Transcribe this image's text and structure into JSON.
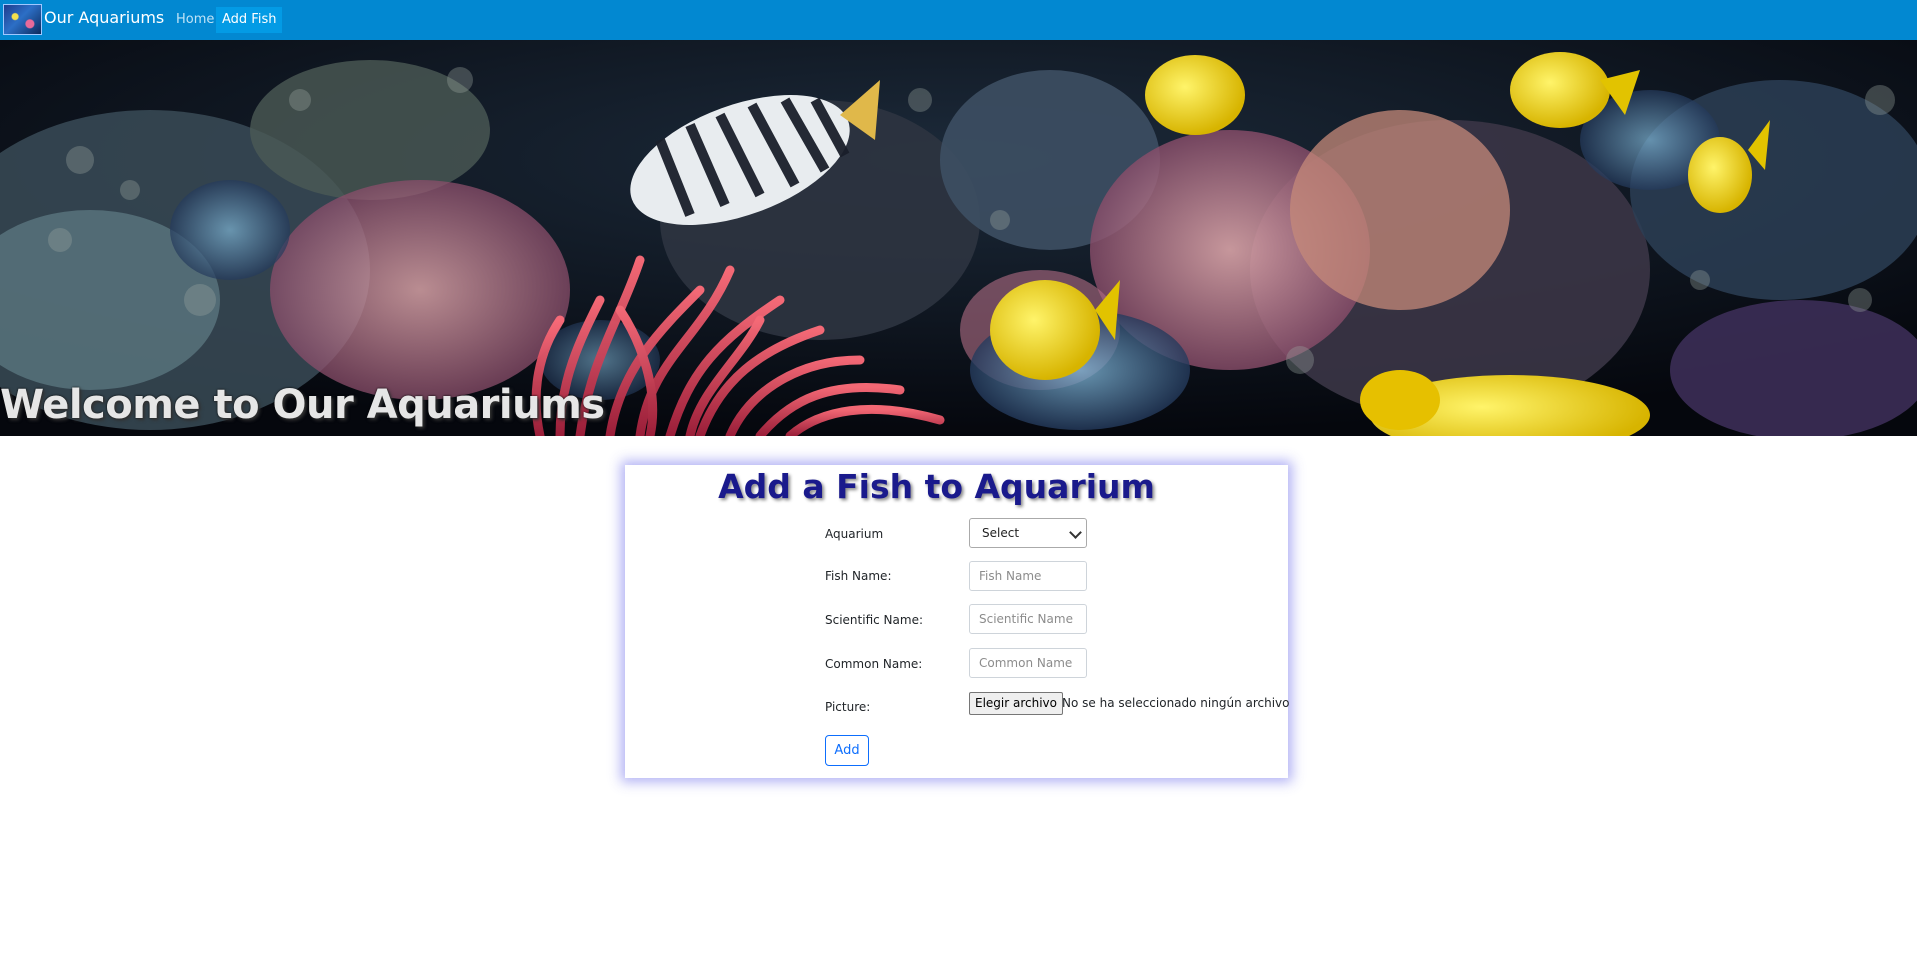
{
  "navbar": {
    "brand": "Our Aquariums",
    "links": [
      {
        "label": "Home",
        "active": false
      },
      {
        "label": "Add Fish",
        "active": true
      }
    ],
    "background": "#0288d1"
  },
  "hero": {
    "title": "Welcome to Our Aquariums"
  },
  "form": {
    "title": "Add a Fish to Aquarium",
    "fields": {
      "aquarium": {
        "label": "Aquarium",
        "value": "Select"
      },
      "fish_name": {
        "label": "Fish Name:",
        "placeholder": "Fish Name"
      },
      "scientific_name": {
        "label": "Scientific Name:",
        "placeholder": "Scientific Name"
      },
      "common_name": {
        "label": "Common Name:",
        "placeholder": "Common Name"
      },
      "picture": {
        "label": "Picture:",
        "button": "Elegir archivo",
        "status": "No se ha seleccionado ningún archivo"
      }
    },
    "submit_label": "Add",
    "accent": "#0d6efd",
    "title_color": "#1a1a8c"
  }
}
